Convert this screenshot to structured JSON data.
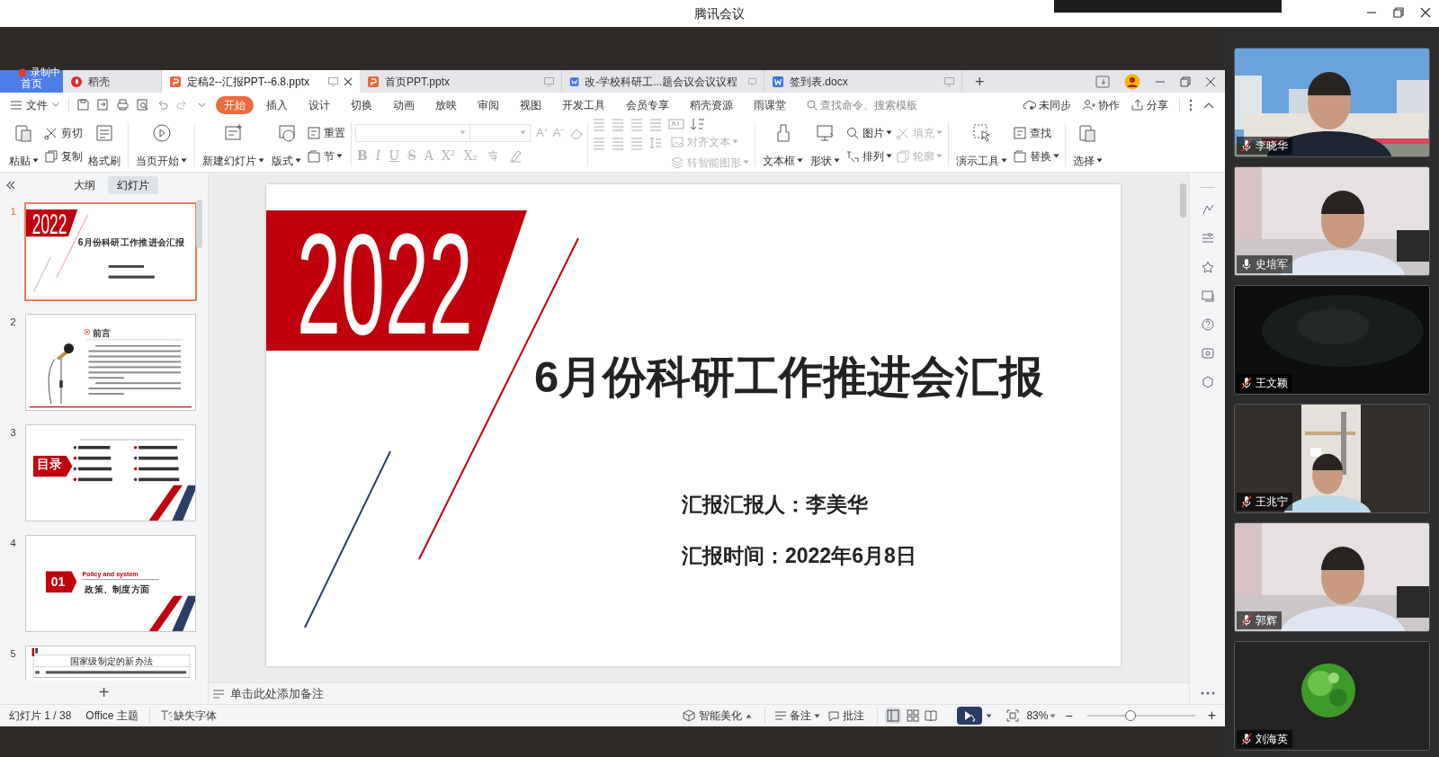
{
  "app_title": "腾讯会议",
  "doc_tabs": [
    {
      "label": "首页",
      "kind": "home",
      "selected": false
    },
    {
      "label": "稻壳",
      "kind": "docer",
      "selected": false
    },
    {
      "label": "定稿2--汇报PPT--6.8.pptx",
      "kind": "ppt",
      "selected": true
    },
    {
      "label": "首页PPT.pptx",
      "kind": "ppt",
      "selected": false
    },
    {
      "label": "改-学校科研工...题会议会议议程",
      "kind": "word",
      "selected": false
    },
    {
      "label": "签到表.docx",
      "kind": "word",
      "selected": false
    }
  ],
  "new_tab": "+",
  "recording_badge": "录制中",
  "menu": {
    "file": "文件",
    "tabs": [
      {
        "label": "开始",
        "selected": true
      },
      {
        "label": "插入",
        "selected": false
      },
      {
        "label": "设计",
        "selected": false
      },
      {
        "label": "切换",
        "selected": false
      },
      {
        "label": "动画",
        "selected": false
      },
      {
        "label": "放映",
        "selected": false
      },
      {
        "label": "审阅",
        "selected": false
      },
      {
        "label": "视图",
        "selected": false
      },
      {
        "label": "开发工具",
        "selected": false
      },
      {
        "label": "会员专享",
        "selected": false
      },
      {
        "label": "稻壳资源",
        "selected": false
      },
      {
        "label": "雨课堂",
        "selected": false
      }
    ],
    "search_placeholder": "查找命令、搜索模板",
    "actions": [
      "未同步",
      "协作",
      "分享"
    ]
  },
  "ribbon": [
    {
      "kind": "tools",
      "columns": [
        {
          "items": [
            {
              "label": "粘贴",
              "dropdown": true,
              "disabled": false
            }
          ]
        },
        {
          "items": [
            {
              "label": "剪切",
              "dropdown": false,
              "disabled": false
            },
            {
              "label": "复制",
              "dropdown": false,
              "disabled": false
            }
          ]
        },
        {
          "items": [
            {
              "label": "格式刷",
              "dropdown": false,
              "disabled": false
            }
          ]
        }
      ]
    },
    {
      "kind": "tools",
      "columns": [
        {
          "items": [
            {
              "label": "当页开始",
              "dropdown": true,
              "disabled": false
            }
          ]
        }
      ]
    },
    {
      "kind": "tools",
      "columns": [
        {
          "items": [
            {
              "label": "新建幻灯片",
              "dropdown": true,
              "disabled": false
            }
          ]
        },
        {
          "items": [
            {
              "label": "版式",
              "dropdown": true,
              "disabled": false
            }
          ]
        },
        {
          "items": [
            {
              "label": "重置",
              "dropdown": false,
              "disabled": false
            },
            {
              "label": "节",
              "dropdown": true,
              "disabled": false
            }
          ]
        }
      ]
    },
    {
      "kind": "font",
      "size_buttons": [
        "A⁺",
        "A⁻"
      ],
      "style_buttons": [
        "B",
        "I",
        "U",
        "S",
        "A",
        "X²",
        "X₂"
      ]
    },
    {
      "kind": "paragraph",
      "items": [
        {
          "label": "对齐文本",
          "dropdown": true,
          "disabled": true
        },
        {
          "label": "转智能图形",
          "dropdown": true,
          "disabled": true
        }
      ]
    },
    {
      "kind": "tools",
      "columns": [
        {
          "items": [
            {
              "label": "文本框",
              "dropdown": true,
              "disabled": false
            }
          ]
        },
        {
          "items": [
            {
              "label": "形状",
              "dropdown": true,
              "disabled": false
            }
          ]
        },
        {
          "items": [
            {
              "label": "图片",
              "dropdown": true,
              "disabled": false
            },
            {
              "label": "排列",
              "dropdown": true,
              "disabled": false
            }
          ]
        },
        {
          "items": [
            {
              "label": "填充",
              "dropdown": true,
              "disabled": true
            },
            {
              "label": "轮廓",
              "dropdown": true,
              "disabled": true
            }
          ]
        }
      ]
    },
    {
      "kind": "tools",
      "columns": [
        {
          "items": [
            {
              "label": "演示工具",
              "dropdown": true,
              "disabled": false
            }
          ]
        },
        {
          "items": [
            {
              "label": "查找",
              "dropdown": false,
              "disabled": false
            },
            {
              "label": "替换",
              "dropdown": true,
              "disabled": false
            }
          ]
        }
      ]
    },
    {
      "kind": "tools",
      "columns": [
        {
          "items": [
            {
              "label": "选择",
              "dropdown": true,
              "disabled": false
            }
          ]
        }
      ]
    }
  ],
  "outline_tabs": [
    {
      "label": "大纲",
      "selected": false
    },
    {
      "label": "幻灯片",
      "selected": true
    }
  ],
  "slides": [
    {
      "number": "1",
      "selected": true,
      "kind": "title",
      "year": "2022",
      "title": "6月份科研工作推进会汇报"
    },
    {
      "number": "2",
      "selected": false,
      "kind": "preface",
      "heading": "前言"
    },
    {
      "number": "3",
      "selected": false,
      "kind": "toc",
      "heading": "目录",
      "items": [
        {
          "color": "#2b3f66"
        },
        {
          "color": "#c0000c"
        },
        {
          "color": "#c0000c"
        },
        {
          "color": "#2b3f66"
        },
        {
          "color": "#2b3f66"
        },
        {
          "color": "#c0000c"
        },
        {
          "color": "#c0000c"
        },
        {
          "color": "#2b3f66"
        }
      ]
    },
    {
      "number": "4",
      "selected": false,
      "kind": "section",
      "badge": "01",
      "subtitle": "Policy and system",
      "title": "政策、制度方面"
    },
    {
      "number": "5",
      "selected": false,
      "kind": "table",
      "title": "国家级制定的新办法"
    }
  ],
  "main_slide": {
    "kind": "title",
    "year": "2022",
    "title": "6月份科研工作推进会汇报",
    "reporter": "汇报汇报人：李美华",
    "time": "汇报时间：2022年6月8日"
  },
  "add_slide": "+",
  "notes_placeholder": "单击此处添加备注",
  "status": {
    "slide_counter": "幻灯片 1 / 38",
    "theme": "Office 主题",
    "missing_fonts": "缺失字体",
    "beautify": "智能美化",
    "notes": "备注",
    "comments": "批注",
    "zoom": "83%",
    "zoom_out": "−",
    "zoom_in": "+",
    "zoom_slider": {
      "level": 0.4
    }
  },
  "participants": [
    {
      "name": "李晓华",
      "muted": true,
      "kind": "camera"
    },
    {
      "name": "史培军",
      "muted": false,
      "kind": "camera"
    },
    {
      "name": "王文颖",
      "muted": true,
      "kind": "dark"
    },
    {
      "name": "王兆宁",
      "muted": true,
      "kind": "portrait"
    },
    {
      "name": "郭辉",
      "muted": true,
      "kind": "camera"
    },
    {
      "name": "刘海英",
      "muted": true,
      "kind": "avatar"
    }
  ]
}
